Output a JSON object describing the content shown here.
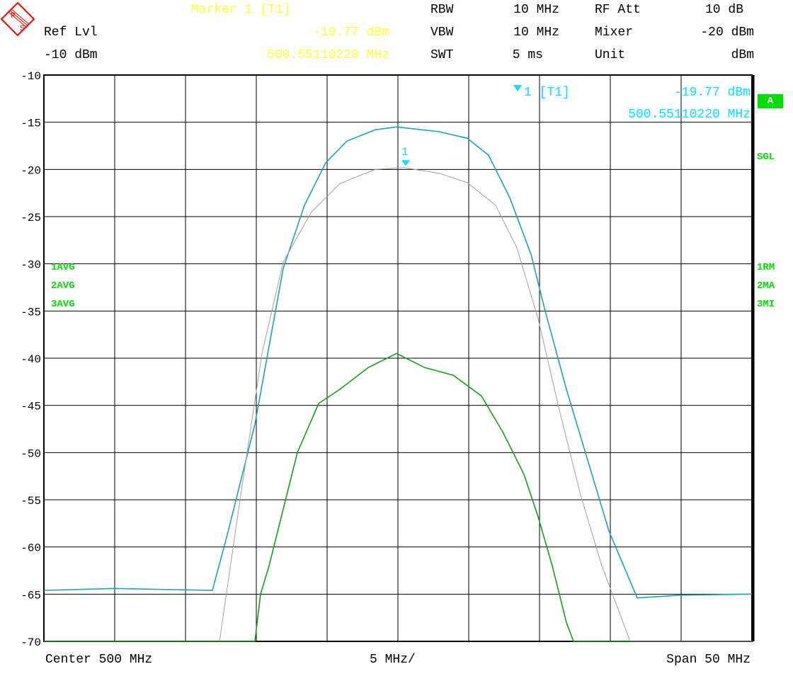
{
  "header": {
    "marker_title": "Marker 1 [T1]",
    "marker_level": "-19.77 dBm",
    "marker_freq": "500.55110220 MHz",
    "ref_lvl_label": "Ref Lvl",
    "ref_lvl_value": "-10 dBm",
    "rbw_label": "RBW",
    "rbw_value": "10 MHz",
    "vbw_label": "VBW",
    "vbw_value": "10 MHz",
    "swt_label": "SWT",
    "swt_value": "5 ms",
    "rfatt_label": "RF Att",
    "rfatt_value": "10 dB",
    "mixer_label": "Mixer",
    "mixer_value": "-20 dBm",
    "unit_label": "Unit",
    "unit_value": "dBm"
  },
  "logo_text": "R&S",
  "plot_marker": {
    "label": "1 [T1]",
    "level": "-19.77 dBm",
    "freq": "500.55110220 MHz",
    "num": "1"
  },
  "side": {
    "a": "A",
    "sgl": "SGL",
    "left": [
      "1AVG",
      "2AVG",
      "3AVG"
    ],
    "right": [
      "1RM",
      "2MA",
      "3MI"
    ]
  },
  "footer": {
    "center": "Center 500 MHz",
    "div": "5 MHz/",
    "span": "Span 50 MHz"
  },
  "colors": {
    "trace1": "#1aa3b0",
    "trace2": "#a0a0a0",
    "trace3": "#1a9a1a",
    "marker": "#00e5ff",
    "header_marker": "#ffff33",
    "status": "#00e000",
    "logo": "#ff0000"
  },
  "chart_data": {
    "type": "line",
    "xlim": [
      475,
      525
    ],
    "ylim": [
      -70,
      -10
    ],
    "yticks": [
      "-10",
      "-15",
      "-20",
      "-25",
      "-30",
      "-35",
      "-40",
      "-45",
      "-50",
      "-55",
      "-60",
      "-65",
      "-70"
    ],
    "grid": true,
    "marker": {
      "x": 500.5511022,
      "y": -19.77
    },
    "series": [
      {
        "name": "1RM",
        "color": "#1aa3b0",
        "points": [
          [
            475,
            -64.6
          ],
          [
            480,
            -64.4
          ],
          [
            486.9,
            -64.6
          ],
          [
            487.9,
            -59
          ],
          [
            489.9,
            -47
          ],
          [
            491.9,
            -30.5
          ],
          [
            493.4,
            -23.8
          ],
          [
            494.9,
            -19.3
          ],
          [
            496.4,
            -17
          ],
          [
            498.4,
            -15.8
          ],
          [
            499.9,
            -15.5
          ],
          [
            502.9,
            -16
          ],
          [
            504.9,
            -16.7
          ],
          [
            506.4,
            -18.5
          ],
          [
            507.9,
            -23
          ],
          [
            509.4,
            -29
          ],
          [
            510.4,
            -35
          ],
          [
            511.9,
            -43.3
          ],
          [
            513.4,
            -50.8
          ],
          [
            514.9,
            -58.3
          ],
          [
            516.9,
            -65.4
          ],
          [
            520,
            -65.1
          ],
          [
            525,
            -65
          ]
        ]
      },
      {
        "name": "2MA",
        "color": "#a0a0a0",
        "points": [
          [
            475,
            -70
          ],
          [
            487.4,
            -70
          ],
          [
            488.9,
            -54.5
          ],
          [
            490.4,
            -39.5
          ],
          [
            491.9,
            -29.8
          ],
          [
            493.9,
            -24.5
          ],
          [
            495.9,
            -21.5
          ],
          [
            498.4,
            -20
          ],
          [
            500.4,
            -19.8
          ],
          [
            502.9,
            -20.4
          ],
          [
            504.9,
            -21.4
          ],
          [
            506.9,
            -23.8
          ],
          [
            508.4,
            -28.3
          ],
          [
            509.9,
            -35.8
          ],
          [
            511.4,
            -45.5
          ],
          [
            512.9,
            -54.5
          ],
          [
            514.4,
            -62
          ],
          [
            516.4,
            -70
          ],
          [
            525,
            -70
          ]
        ]
      },
      {
        "name": "3MI",
        "color": "#1a9a1a",
        "points": [
          [
            475,
            -70
          ],
          [
            489.9,
            -70
          ],
          [
            490.3,
            -65
          ],
          [
            490.9,
            -62
          ],
          [
            491.9,
            -56
          ],
          [
            492.9,
            -50
          ],
          [
            494.4,
            -44.8
          ],
          [
            495.9,
            -43.3
          ],
          [
            497.9,
            -41
          ],
          [
            499.9,
            -39.5
          ],
          [
            501.9,
            -41
          ],
          [
            503.9,
            -41.8
          ],
          [
            505.9,
            -44
          ],
          [
            507.4,
            -47.8
          ],
          [
            508.9,
            -52.3
          ],
          [
            509.9,
            -56.8
          ],
          [
            510.9,
            -62
          ],
          [
            511.9,
            -68
          ],
          [
            512.4,
            -70
          ],
          [
            516.4,
            -70
          ]
        ]
      }
    ]
  }
}
